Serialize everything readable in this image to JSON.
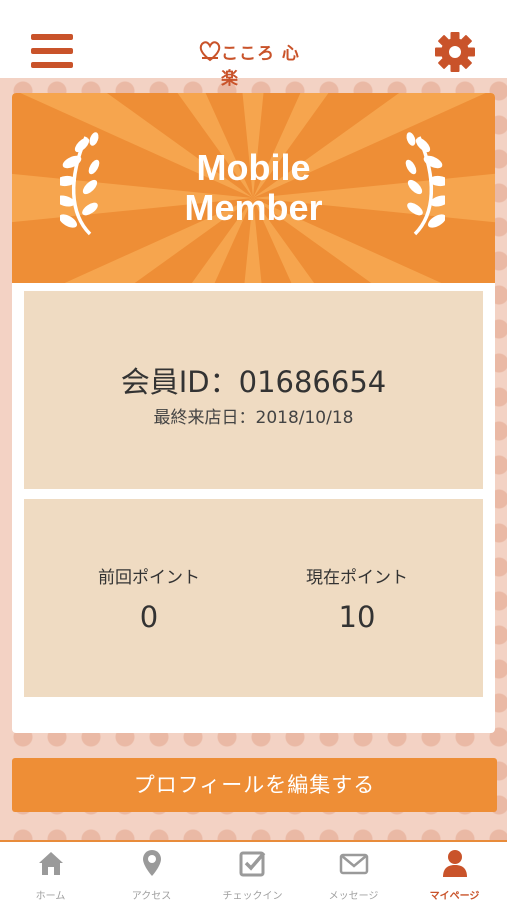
{
  "header": {
    "menu_icon": "hamburger-menu-icon",
    "logo_text": "こころ 心楽",
    "settings_icon": "gear-icon"
  },
  "banner": {
    "title_line1": "Mobile",
    "title_line2": "Member"
  },
  "member": {
    "id_text": "会員ID：01686654",
    "last_visit_text": "最終来店日：2018/10/18"
  },
  "points": {
    "previous_label": "前回ポイント",
    "previous_value": "0",
    "current_label": "現在ポイント",
    "current_value": "10"
  },
  "actions": {
    "edit_profile_label": "プロフィールを編集する"
  },
  "tabs": [
    {
      "label": "ホーム",
      "icon": "home-icon",
      "active": false
    },
    {
      "label": "アクセス",
      "icon": "location-pin-icon",
      "active": false
    },
    {
      "label": "チェックイン",
      "icon": "checkin-icon",
      "active": false
    },
    {
      "label": "メッセージ",
      "icon": "mail-icon",
      "active": false
    },
    {
      "label": "マイページ",
      "icon": "person-icon",
      "active": true
    }
  ],
  "colors": {
    "accent": "#ee8e36",
    "brand": "#c9532a",
    "panel": "#efdbc2",
    "background": "#f3d2c4"
  }
}
